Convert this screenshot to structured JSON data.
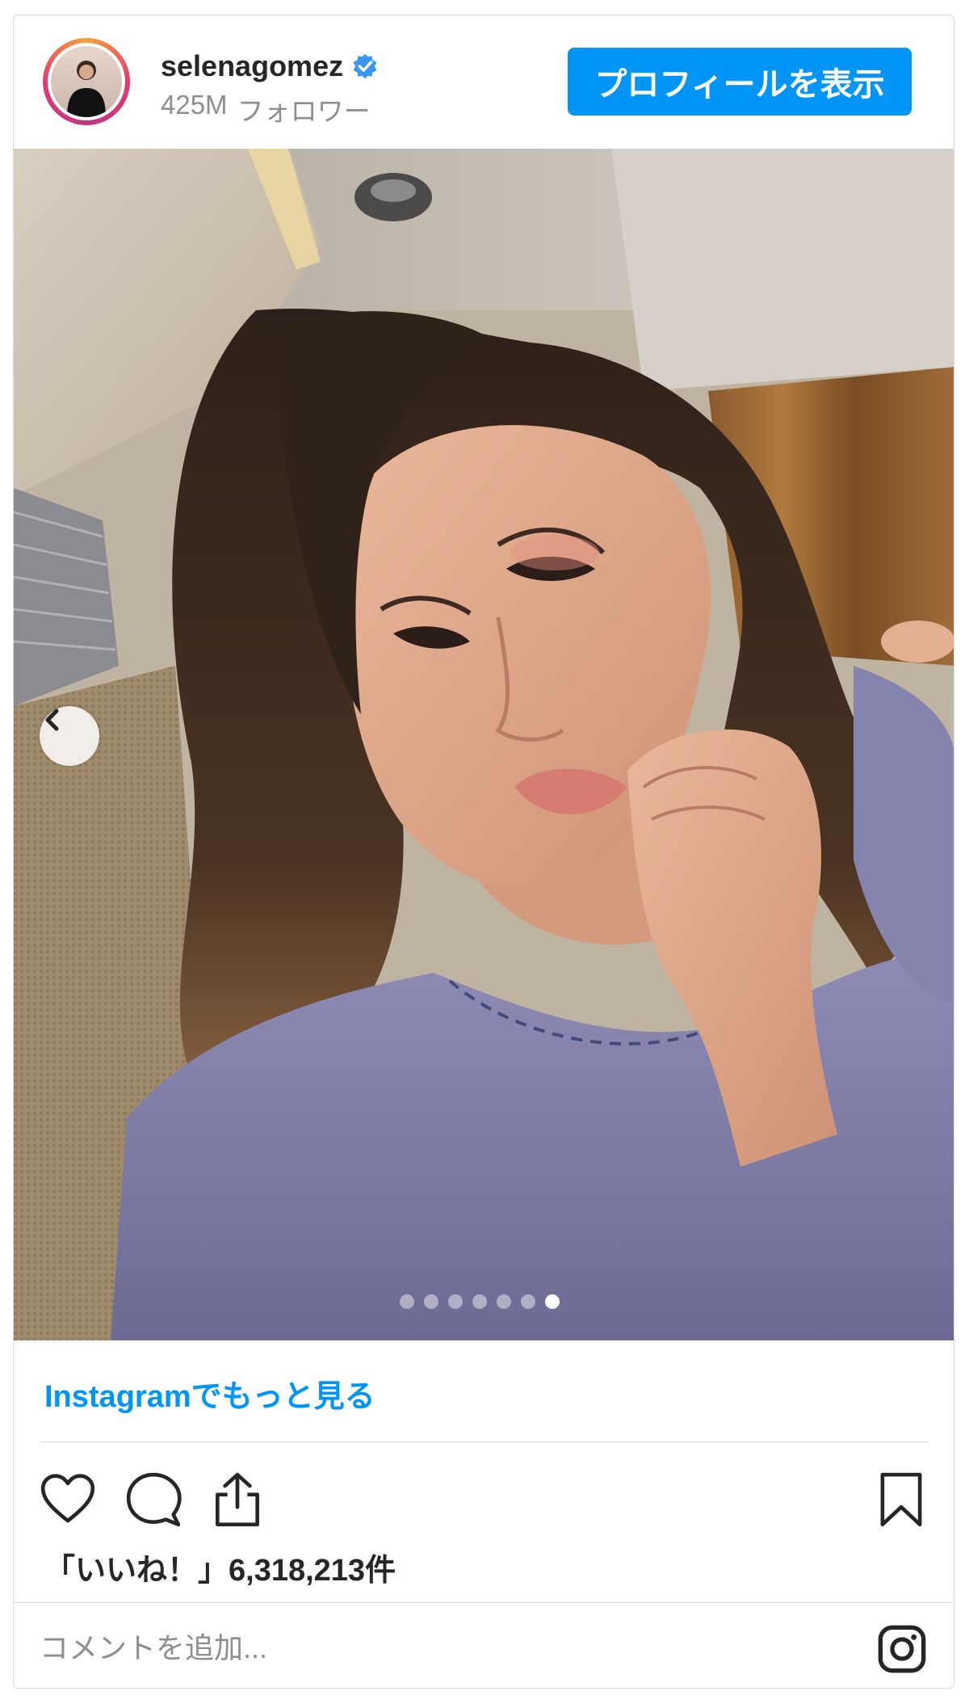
{
  "header": {
    "username": "selenagomez",
    "followers_count": "425M",
    "followers_label": "フォロワー",
    "profile_button": "プロフィールを表示"
  },
  "carousel": {
    "total_slides": 7,
    "active_index": 6
  },
  "more_link": "Instagramでもっと見る",
  "likes": {
    "prefix": "「いいね！」",
    "count": "6,318,213件"
  },
  "comment": {
    "placeholder": "コメントを追加..."
  },
  "icons": {
    "verified": "verified-badge-icon",
    "prev": "chevron-left-icon",
    "like": "heart-icon",
    "comment": "comment-bubble-icon",
    "share": "share-upload-icon",
    "save": "bookmark-icon",
    "brand": "instagram-icon"
  },
  "colors": {
    "accent": "#0095f6",
    "text": "#262626",
    "muted": "#8e8e8e",
    "border": "#dbdbdb"
  }
}
